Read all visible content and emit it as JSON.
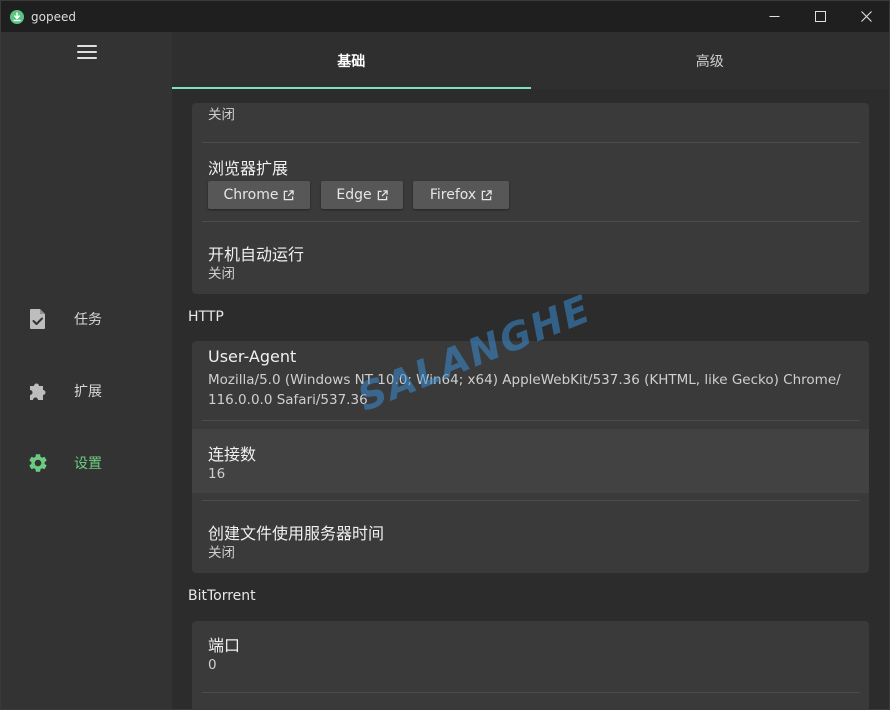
{
  "window": {
    "title": "gopeed"
  },
  "colors": {
    "accent": "#6ccb82",
    "tab_indicator": "#7ee2c0",
    "watermark": "#3a8cd2"
  },
  "sidebar": {
    "menu_icon": "hamburger-menu-icon",
    "items": [
      {
        "label": "任务",
        "icon": "task-file-check-icon",
        "active": false
      },
      {
        "label": "扩展",
        "icon": "puzzle-piece-icon",
        "active": false
      },
      {
        "label": "设置",
        "icon": "gear-icon",
        "active": true
      }
    ]
  },
  "tabs": [
    {
      "label": "基础",
      "active": true
    },
    {
      "label": "高级",
      "active": false
    }
  ],
  "general": {
    "partial_value": "关闭",
    "browser_ext_title": "浏览器扩展",
    "browser_ext_buttons": [
      {
        "label": "Chrome"
      },
      {
        "label": "Edge"
      },
      {
        "label": "Firefox"
      }
    ],
    "autostart_title": "开机自动运行",
    "autostart_value": "关闭"
  },
  "http": {
    "section": "HTTP",
    "ua_title": "User-Agent",
    "ua_value_line1": "Mozilla/5.0 (Windows NT 10.0; Win64; x64) AppleWebKit/537.36 (KHTML, like Gecko) Chrome/",
    "ua_value_line2": "116.0.0.0 Safari/537.36",
    "connections_title": "连接数",
    "connections_value": "16",
    "server_time_title": "创建文件使用服务器时间",
    "server_time_value": "关闭"
  },
  "bittorrent": {
    "section": "BitTorrent",
    "port_title": "端口",
    "port_value": "0"
  },
  "watermark": {
    "text": "SALANGHE"
  }
}
